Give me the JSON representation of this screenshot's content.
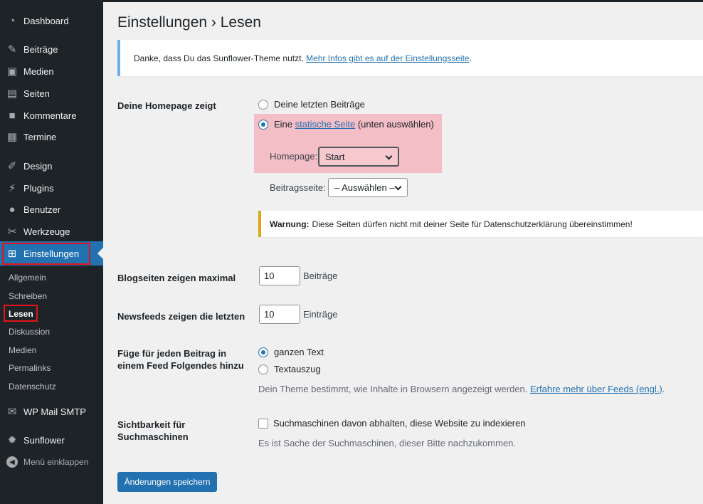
{
  "sidebar": {
    "items": [
      {
        "label": "Dashboard",
        "icon": "dashboard-icon"
      },
      {
        "label": "Beiträge",
        "icon": "pin-icon"
      },
      {
        "label": "Medien",
        "icon": "media-icon"
      },
      {
        "label": "Seiten",
        "icon": "pages-icon"
      },
      {
        "label": "Kommentare",
        "icon": "comments-icon"
      },
      {
        "label": "Termine",
        "icon": "calendar-icon"
      },
      {
        "label": "Design",
        "icon": "brush-icon"
      },
      {
        "label": "Plugins",
        "icon": "plugin-icon"
      },
      {
        "label": "Benutzer",
        "icon": "user-icon"
      },
      {
        "label": "Werkzeuge",
        "icon": "wrench-icon"
      },
      {
        "label": "Einstellungen",
        "icon": "settings-icon"
      },
      {
        "label": "WP Mail SMTP",
        "icon": "mail-icon"
      },
      {
        "label": "Sunflower",
        "icon": "gear-icon"
      }
    ],
    "submenu": [
      "Allgemein",
      "Schreiben",
      "Lesen",
      "Diskussion",
      "Medien",
      "Permalinks",
      "Datenschutz"
    ],
    "collapse_label": "Menü einklappen"
  },
  "page": {
    "title": "Einstellungen › Lesen"
  },
  "notice": {
    "text": "Danke, dass Du das Sunflower-Theme nutzt.",
    "link": "Mehr Infos gibt es auf der Einstellungsseite",
    "suffix": "."
  },
  "homepage": {
    "label": "Deine Homepage zeigt",
    "option_posts": "Deine letzten Beiträge",
    "option_static_prefix": "Eine",
    "option_static_link": "statische Seite",
    "option_static_suffix": "(unten auswählen)",
    "homepage_label": "Homepage:",
    "homepage_value": "Start",
    "postspage_label": "Beitragsseite:",
    "postspage_value": "– Auswählen –"
  },
  "warning": {
    "strong": "Warnung:",
    "text": "Diese Seiten dürfen nicht mit deiner Seite für Datenschutzerklärung übereinstimmen!"
  },
  "blog_pages": {
    "label": "Blogseiten zeigen maximal",
    "value": "10",
    "unit": "Beiträge"
  },
  "feeds": {
    "label": "Newsfeeds zeigen die letzten",
    "value": "10",
    "unit": "Einträge"
  },
  "feed_content": {
    "label_line1": "Füge für jeden Beitrag in",
    "label_line2": "einem Feed Folgendes hinzu",
    "option_full": "ganzen Text",
    "option_excerpt": "Textauszug",
    "desc": "Dein Theme bestimmt, wie Inhalte in Browsern angezeigt werden.",
    "desc_link": "Erfahre mehr über Feeds (engl.)",
    "desc_suffix": "."
  },
  "visibility": {
    "label_line1": "Sichtbarkeit für",
    "label_line2": "Suchmaschinen",
    "checkbox_label": "Suchmaschinen davon abhalten, diese Website zu indexieren",
    "desc": "Es ist Sache der Suchmaschinen, dieser Bitte nachzukommen."
  },
  "save_button": "Änderungen speichern",
  "colors": {
    "accent": "#2271b1",
    "sidebar": "#1d2327",
    "highlight": "#f3bec5",
    "outline": "#e2131a",
    "warning": "#dba617"
  }
}
